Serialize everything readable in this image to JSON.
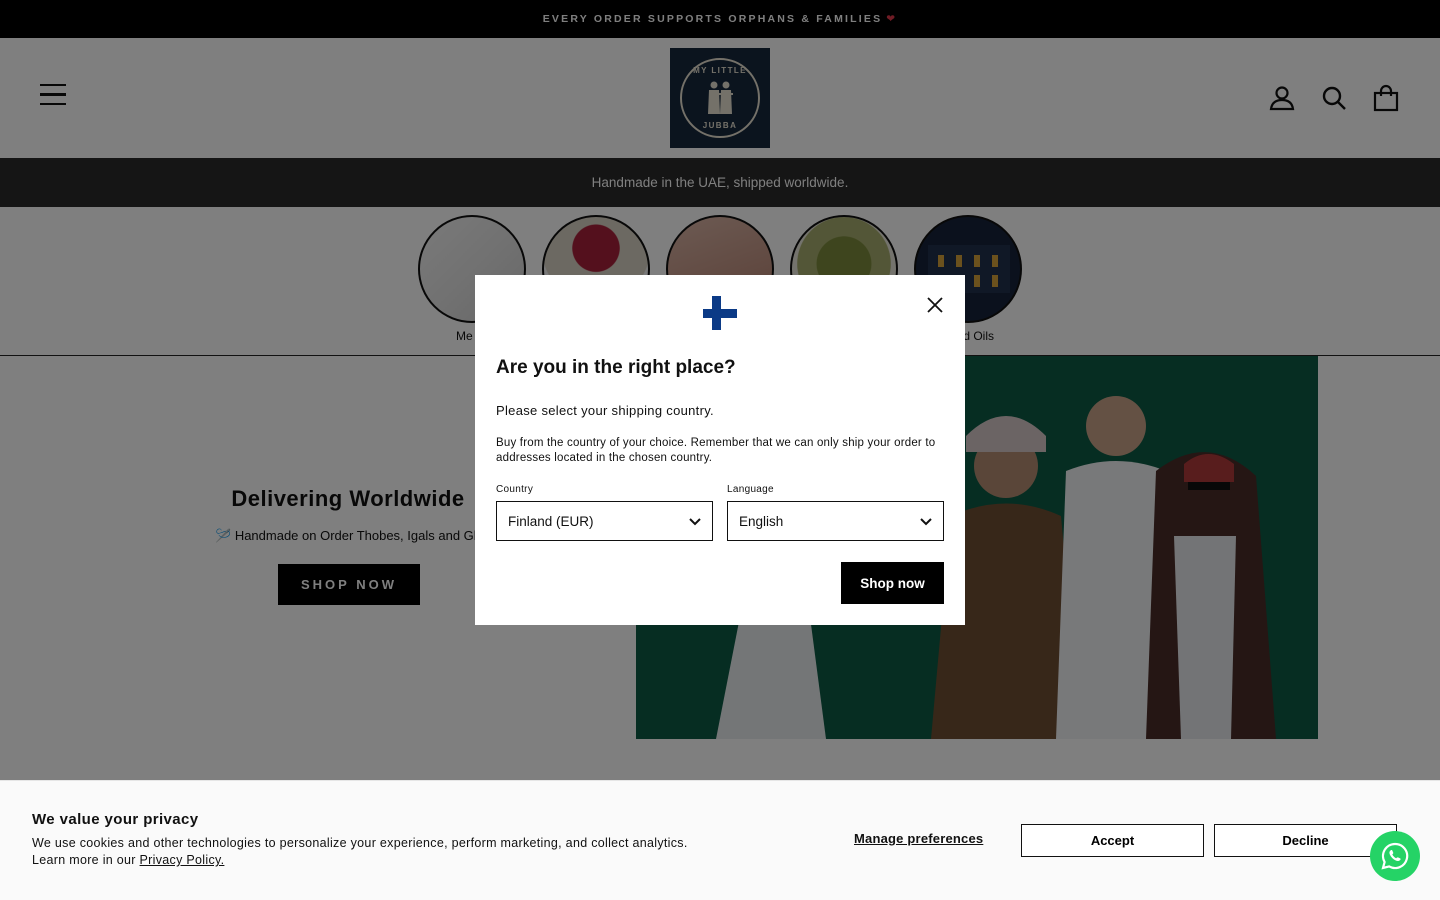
{
  "announcement": {
    "text": "EVERY ORDER SUPPORTS ORPHANS & FAMILIES",
    "heart": "❤"
  },
  "header": {
    "logo": {
      "line1": "MY LITTLE",
      "line2": "JUBBA"
    }
  },
  "promo": {
    "text": "Handmade in the UAE, shipped worldwide."
  },
  "categories": [
    {
      "label": "Me"
    },
    {
      "label": ""
    },
    {
      "label": ""
    },
    {
      "label": ""
    },
    {
      "label": "d Oils"
    }
  ],
  "hero": {
    "title": "Delivering Worldwide",
    "subtitle_icon": "🪡",
    "subtitle": "Handmade on Order Thobes, Igals and Gh",
    "button": "SHOP NOW"
  },
  "modal": {
    "title": "Are you in the right place?",
    "p1": "Please select your shipping country.",
    "p2": "Buy from the country of your choice. Remember that we can only ship your order to addresses located in the chosen country.",
    "country_label": "Country",
    "country_value": "Finland (EUR)",
    "language_label": "Language",
    "language_value": "English",
    "button": "Shop now",
    "flag_colors": {
      "cross": "#0b3a86",
      "field": "#ffffff"
    }
  },
  "cookie": {
    "title": "We value your privacy",
    "text": "We use cookies and other technologies to personalize your experience, perform marketing, and collect analytics.",
    "learn_prefix": "Learn more in our",
    "link": "Privacy Policy.",
    "manage": "Manage preferences",
    "accept": "Accept",
    "decline": "Decline"
  },
  "colors": {
    "accent": "#000000",
    "whatsapp": "#25d366",
    "hero_bg": "#0d5a44"
  }
}
